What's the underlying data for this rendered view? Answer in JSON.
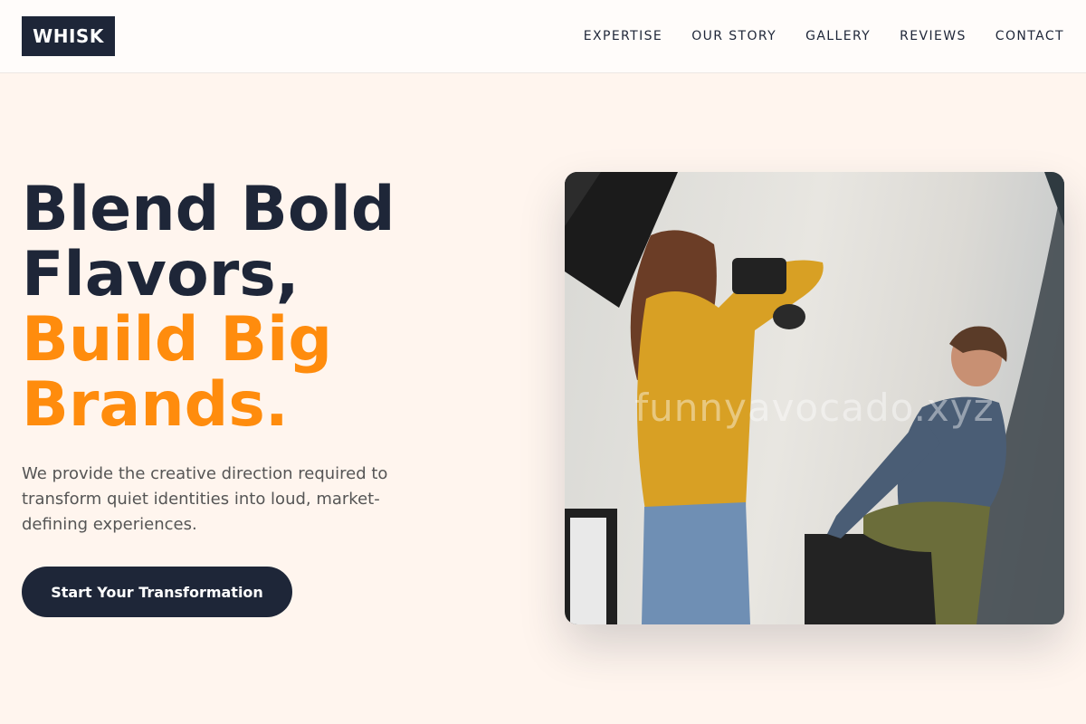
{
  "brand": {
    "name": "WHISK"
  },
  "nav": {
    "items": [
      "EXPERTISE",
      "OUR STORY",
      "GALLERY",
      "REVIEWS",
      "CONTACT"
    ]
  },
  "hero": {
    "title_lines": [
      "Blend Bold",
      "Flavors,"
    ],
    "title_accent_lines": [
      "Build Big",
      "Brands."
    ],
    "subtitle": "We provide the creative direction required to transform quiet identities into loud, market-defining experiences.",
    "cta_label": "Start Your Transformation",
    "image": {
      "watermark": "funnyavocado.xyz",
      "alt": "photographer-and-model-photo"
    }
  },
  "colors": {
    "background": "#fff5ee",
    "navy": "#1e2638",
    "accent": "#ff8c0d",
    "body_text": "#555555"
  }
}
